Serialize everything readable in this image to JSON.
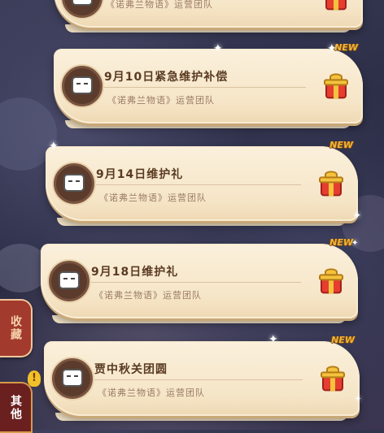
{
  "items": [
    {
      "title": "",
      "subtitle": "《诺弗兰物语》运营团队",
      "badge": ""
    },
    {
      "title": "9月10日紧急维护补偿",
      "subtitle": "《诺弗兰物语》运营团队",
      "badge": "NEW"
    },
    {
      "title": "9月14日维护礼",
      "subtitle": "《诺弗兰物语》运营团队",
      "badge": "NEW"
    },
    {
      "title": "9月18日维护礼",
      "subtitle": "《诺弗兰物语》运营团队",
      "badge": "NEW"
    },
    {
      "title": "贾中秋关团圆",
      "subtitle": "《诺弗兰物语》运营团队",
      "badge": "NEW"
    }
  ],
  "side": {
    "collect_label": "收藏",
    "other_label": "其他",
    "alert_mark": "!"
  },
  "colors": {
    "card": "#f6e6c8",
    "title": "#5a3b22",
    "gift_red": "#e53d2f",
    "gift_gold": "#f4c23d",
    "new_badge": "#f2b43a"
  }
}
